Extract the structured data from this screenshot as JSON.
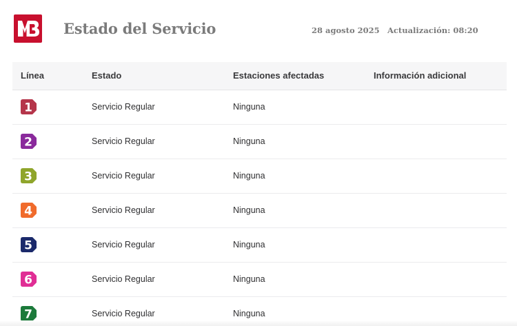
{
  "header": {
    "logo_name": "metro-logo",
    "title": "Estado del Servicio",
    "date": "28 agosto 2025",
    "update": "Actualización: 08:20"
  },
  "table": {
    "columns": [
      "Línea",
      "Estado",
      "Estaciones afectadas",
      "Información adicional"
    ],
    "rows": [
      {
        "line": "1",
        "color": "#b5354a",
        "status": "Servicio Regular",
        "stations": "Ninguna",
        "info": ""
      },
      {
        "line": "2",
        "color": "#8a2a9c",
        "status": "Servicio Regular",
        "stations": "Ninguna",
        "info": ""
      },
      {
        "line": "3",
        "color": "#8fa52b",
        "status": "Servicio Regular",
        "stations": "Ninguna",
        "info": ""
      },
      {
        "line": "4",
        "color": "#f06b2c",
        "status": "Servicio Regular",
        "stations": "Ninguna",
        "info": ""
      },
      {
        "line": "5",
        "color": "#1b2a6b",
        "status": "Servicio Regular",
        "stations": "Ninguna",
        "info": ""
      },
      {
        "line": "6",
        "color": "#e02e95",
        "status": "Servicio Regular",
        "stations": "Ninguna",
        "info": ""
      },
      {
        "line": "7",
        "color": "#1c7a3b",
        "status": "Servicio Regular",
        "stations": "Ninguna",
        "info": ""
      }
    ]
  },
  "colors": {
    "brand": "#c8102e",
    "title_text": "#7b7b7b",
    "header_bg": "#f6f6f7"
  }
}
